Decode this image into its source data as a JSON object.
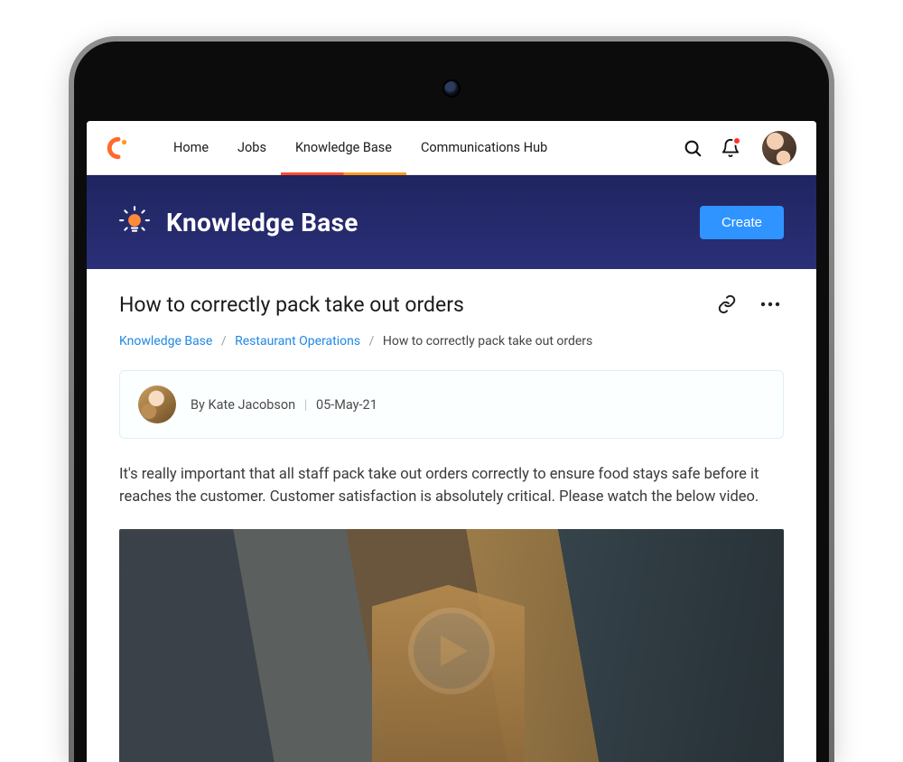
{
  "nav": {
    "items": [
      {
        "label": "Home"
      },
      {
        "label": "Jobs"
      },
      {
        "label": "Knowledge Base",
        "active": true
      },
      {
        "label": "Communications Hub"
      }
    ],
    "search_icon": "search-icon",
    "notifications_icon": "bell-icon",
    "has_unread_notifications": true
  },
  "hero": {
    "title": "Knowledge Base",
    "create_label": "Create"
  },
  "article": {
    "title": "How to correctly pack take out orders",
    "breadcrumbs": [
      {
        "label": "Knowledge Base",
        "link": true
      },
      {
        "label": "Restaurant Operations",
        "link": true
      },
      {
        "label": "How to correctly pack take out orders",
        "link": false
      }
    ],
    "author": {
      "by_prefix": "By ",
      "name": "Kate Jacobson",
      "date": "05-May-21"
    },
    "body": "It's really important that all staff pack take out orders correctly to ensure food stays safe before it reaches the customer. Customer satisfaction is absolutely critical. Please watch the below video."
  },
  "colors": {
    "hero_bg": "#232868",
    "accent_blue": "#2f94ff",
    "link_blue": "#1e88e5",
    "brand_gradient_from": "#ff4d2e",
    "brand_gradient_to": "#ff9a1f"
  }
}
